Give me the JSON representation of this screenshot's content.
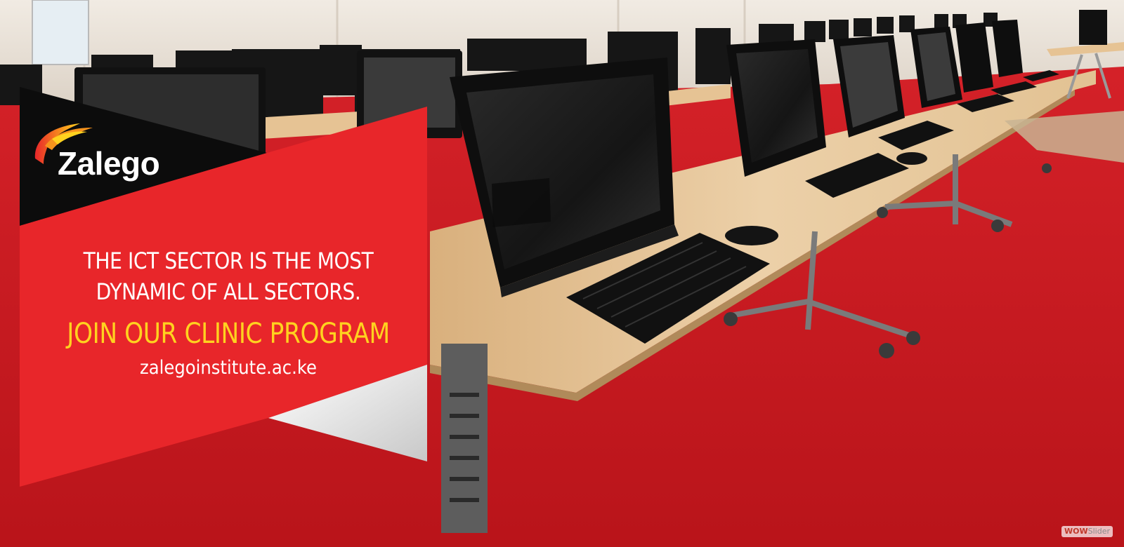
{
  "banner": {
    "brand": "Zalego",
    "headline_line1": "THE ICT SECTOR IS THE MOST",
    "headline_line2": "DYNAMIC OF ALL SECTORS.",
    "cta": "JOIN OUR CLINIC PROGRAM",
    "url": "zalegoinstitute.ac.ke",
    "photo_icon": "computer-lab-photo-icon",
    "logo_icon": "zalego-flame-logo-icon"
  },
  "watermark": {
    "part1": "WOW",
    "part2": "Slider"
  },
  "colors": {
    "brand_red": "#e8262a",
    "cta_yellow": "#ffd21f",
    "carpet_red": "#c8171c",
    "panel_black": "#0c0c0c",
    "desk_wood": "#e7c79d"
  }
}
